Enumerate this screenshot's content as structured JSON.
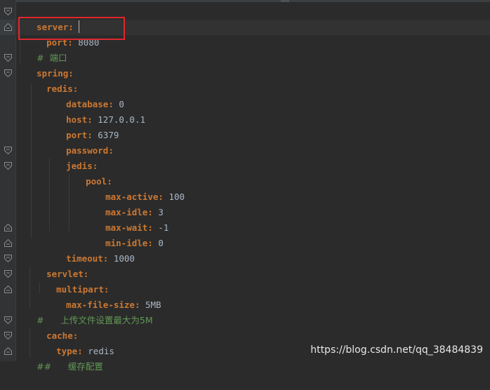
{
  "editor": {
    "lines": [
      {
        "key": "server:",
        "value": "",
        "comment": ""
      },
      {
        "key": "port:",
        "value": "8080",
        "comment": ""
      },
      {
        "key": "",
        "value": "",
        "comment": "#  端口"
      },
      {
        "key": "spring:",
        "value": "",
        "comment": ""
      },
      {
        "key": "redis:",
        "value": "",
        "comment": ""
      },
      {
        "key": "database:",
        "value": "0",
        "comment": ""
      },
      {
        "key": "host:",
        "value": "127.0.0.1",
        "comment": ""
      },
      {
        "key": "port:",
        "value": "6379",
        "comment": ""
      },
      {
        "key": "password:",
        "value": "",
        "comment": ""
      },
      {
        "key": "jedis:",
        "value": "",
        "comment": ""
      },
      {
        "key": "pool:",
        "value": "",
        "comment": ""
      },
      {
        "key": "max-active:",
        "value": "100",
        "comment": ""
      },
      {
        "key": "max-idle:",
        "value": "3",
        "comment": ""
      },
      {
        "key": "max-wait:",
        "value": "-1",
        "comment": ""
      },
      {
        "key": "min-idle:",
        "value": "0",
        "comment": ""
      },
      {
        "key": "timeout:",
        "value": "1000",
        "comment": ""
      },
      {
        "key": "servlet:",
        "value": "",
        "comment": ""
      },
      {
        "key": "multipart:",
        "value": "",
        "comment": ""
      },
      {
        "key": "max-file-size:",
        "value": "5MB",
        "comment": ""
      },
      {
        "key": "",
        "value": "",
        "comment": "#      上传文件设置最大为5M"
      },
      {
        "key": "cache:",
        "value": "",
        "comment": ""
      },
      {
        "key": "type:",
        "value": "redis",
        "comment": ""
      },
      {
        "key": "",
        "value": "",
        "comment": "##      缓存配置"
      }
    ]
  },
  "watermark": "https://blog.csdn.net/qq_38484839",
  "colors": {
    "background": "#2b2b2b",
    "key": "#cc7832",
    "value": "#a9b7c6",
    "comment": "#629755",
    "highlight_box": "#e0262e"
  }
}
